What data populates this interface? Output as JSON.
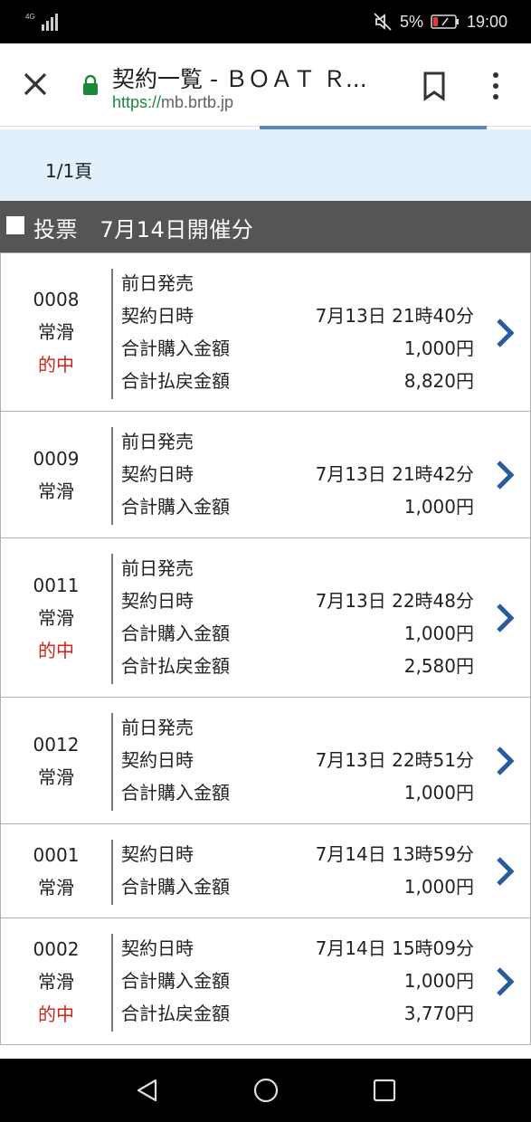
{
  "status_bar": {
    "network": "4G",
    "battery": "5%",
    "time": "19:00",
    "icons": [
      "signal-icon",
      "mute-icon",
      "battery-icon"
    ]
  },
  "browser": {
    "title": "契約一覧 - ＢＯＡＴ Ｒ...",
    "url_scheme": "https://",
    "url_host": "mb.brtb.jp",
    "icons": [
      "close-icon",
      "lock-icon",
      "bookmark-icon",
      "more-vert-icon"
    ]
  },
  "pager": {
    "text": "1/1頁"
  },
  "section": {
    "title": "投票　7月14日開催分"
  },
  "colors": {
    "accent_blue": "#2a5aa0",
    "hit_red": "#d1221a",
    "header_gray": "#555555",
    "pager_bg": "#e2f0fb"
  },
  "tickets": [
    {
      "number": "0008",
      "venue": "常滑",
      "hit": "的中",
      "rows": [
        {
          "label": "前日発売",
          "value": ""
        },
        {
          "label": "契約日時",
          "value": "7月13日 21時40分"
        },
        {
          "label": "合計購入金額",
          "value": "1,000円"
        },
        {
          "label": "合計払戻金額",
          "value": "8,820円"
        }
      ]
    },
    {
      "number": "0009",
      "venue": "常滑",
      "hit": "",
      "rows": [
        {
          "label": "前日発売",
          "value": ""
        },
        {
          "label": "契約日時",
          "value": "7月13日 21時42分"
        },
        {
          "label": "合計購入金額",
          "value": "1,000円"
        }
      ]
    },
    {
      "number": "0011",
      "venue": "常滑",
      "hit": "的中",
      "rows": [
        {
          "label": "前日発売",
          "value": ""
        },
        {
          "label": "契約日時",
          "value": "7月13日 22時48分"
        },
        {
          "label": "合計購入金額",
          "value": "1,000円"
        },
        {
          "label": "合計払戻金額",
          "value": "2,580円"
        }
      ]
    },
    {
      "number": "0012",
      "venue": "常滑",
      "hit": "",
      "rows": [
        {
          "label": "前日発売",
          "value": ""
        },
        {
          "label": "契約日時",
          "value": "7月13日 22時51分"
        },
        {
          "label": "合計購入金額",
          "value": "1,000円"
        }
      ]
    },
    {
      "number": "0001",
      "venue": "常滑",
      "hit": "",
      "rows": [
        {
          "label": "契約日時",
          "value": "7月14日 13時59分"
        },
        {
          "label": "合計購入金額",
          "value": "1,000円"
        }
      ]
    },
    {
      "number": "0002",
      "venue": "常滑",
      "hit": "的中",
      "rows": [
        {
          "label": "契約日時",
          "value": "7月14日 15時09分"
        },
        {
          "label": "合計購入金額",
          "value": "1,000円"
        },
        {
          "label": "合計払戻金額",
          "value": "3,770円"
        }
      ]
    }
  ],
  "nav_bar": {
    "icons": [
      "back-nav-icon",
      "home-nav-icon",
      "recents-nav-icon"
    ]
  }
}
